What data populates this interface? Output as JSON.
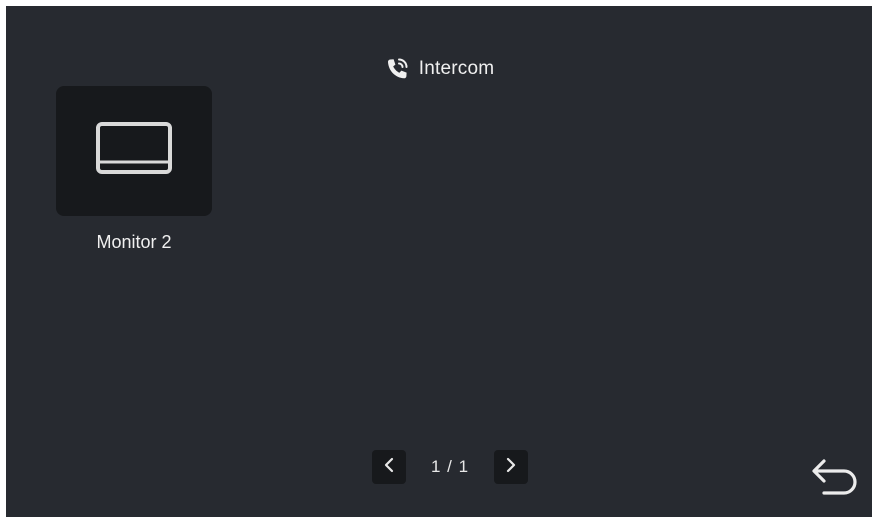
{
  "header": {
    "title": "Intercom",
    "icon": "phone-icon"
  },
  "devices": [
    {
      "label": "Monitor 2",
      "icon": "monitor-icon"
    }
  ],
  "pagination": {
    "indicator": "1 / 1",
    "prev_icon": "chevron-left-icon",
    "next_icon": "chevron-right-icon"
  },
  "back_button": {
    "icon": "return-arrow-icon"
  },
  "colors": {
    "background": "#272a30",
    "tile": "#17191c",
    "text": "#f0f0f0",
    "icon": "#e0e0e0"
  }
}
